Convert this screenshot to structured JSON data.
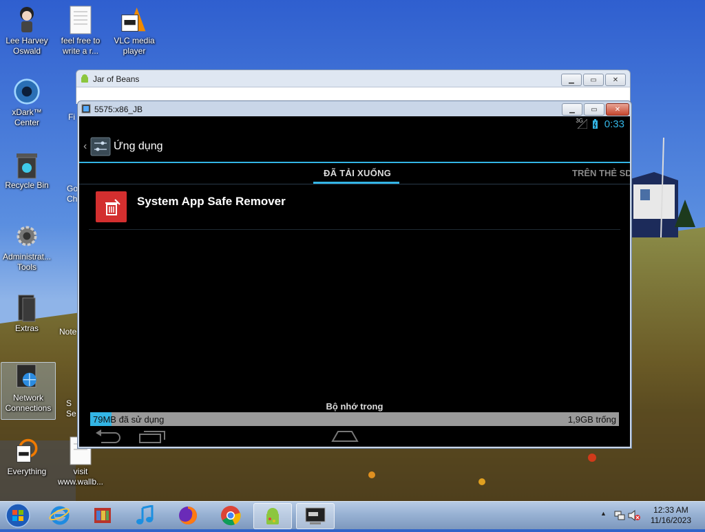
{
  "desktop": {
    "icons": [
      {
        "label": "Lee Harvey Oswald"
      },
      {
        "label": "feel free to write a r..."
      },
      {
        "label": "VLC media player"
      },
      {
        "label": "xDark™ Center"
      },
      {
        "label": "Recycle Bin"
      },
      {
        "label": "Administrat... Tools"
      },
      {
        "label": "Extras"
      },
      {
        "label": "Network Connections"
      },
      {
        "label": "Everything"
      },
      {
        "label": "visit www.wallb..."
      }
    ],
    "partial_labels": [
      "Fi",
      "Go Ch",
      "Note",
      "S Se"
    ]
  },
  "jar_window": {
    "title": "Jar of Beans"
  },
  "emulator_window": {
    "title": "5575:x86_JB"
  },
  "android": {
    "status_signal": "3G",
    "clock": "0:33",
    "action_title": "Ứng dụng",
    "tabs": [
      {
        "label": "ĐÃ TẢI XUỐNG",
        "selected": true
      },
      {
        "label": "TRÊN THẺ SD",
        "selected": false
      }
    ],
    "apps": [
      {
        "name": "System App Safe Remover"
      }
    ],
    "storage": {
      "label": "Bộ nhớ trong",
      "used_text": "79MB đã sử dụng",
      "free_text": "1,9GB trống",
      "used_fraction": 0.04
    }
  },
  "taskbar": {
    "time": "12:33 AM",
    "date": "11/16/2023"
  },
  "colors": {
    "android_accent": "#33b5e5",
    "app_icon_red": "#d32f2f"
  }
}
